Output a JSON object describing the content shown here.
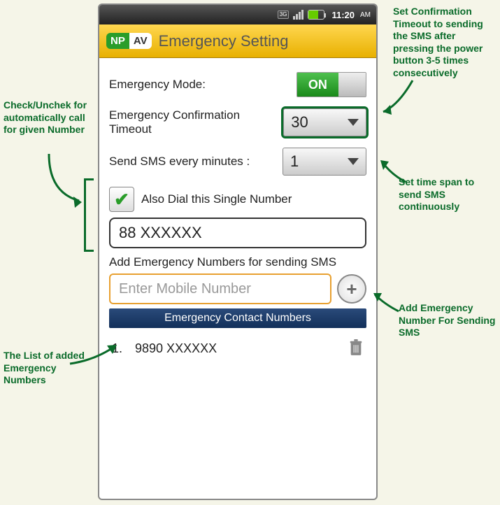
{
  "status_bar": {
    "network_icon": "3G",
    "time": "11:20",
    "ampm": "AM"
  },
  "header": {
    "logo_left": "NP",
    "logo_right": "AV",
    "title": "Emergency Setting"
  },
  "settings": {
    "emergency_mode_label": "Emergency Mode:",
    "toggle_text": "ON",
    "timeout_label": "Emergency Confirmation Timeout",
    "timeout_value": "30",
    "sms_every_label": "Send SMS every minutes :",
    "sms_every_value": "1",
    "dial_checkbox_label": "Also Dial this Single Number",
    "dial_checkbox_checked": true,
    "dial_number": "88 XXXXXX",
    "add_section_label": "Add Emergency Numbers for sending SMS",
    "mobile_placeholder": "Enter Mobile Number",
    "list_header": "Emergency Contact Numbers",
    "contacts": [
      {
        "index": "1.",
        "number": "9890 XXXXXX"
      }
    ]
  },
  "annotations": {
    "timeout_note": "Set Confirmation Timeout to sending the SMS after pressing the power button 3-5 times consecutively",
    "check_note": "Check/Unchek for automatically call for given Number",
    "sms_span_note": "Set time span to send SMS continuously",
    "add_note": "Add Emergency Number For Sending SMS",
    "list_note": "The List of added Emergency Numbers"
  }
}
